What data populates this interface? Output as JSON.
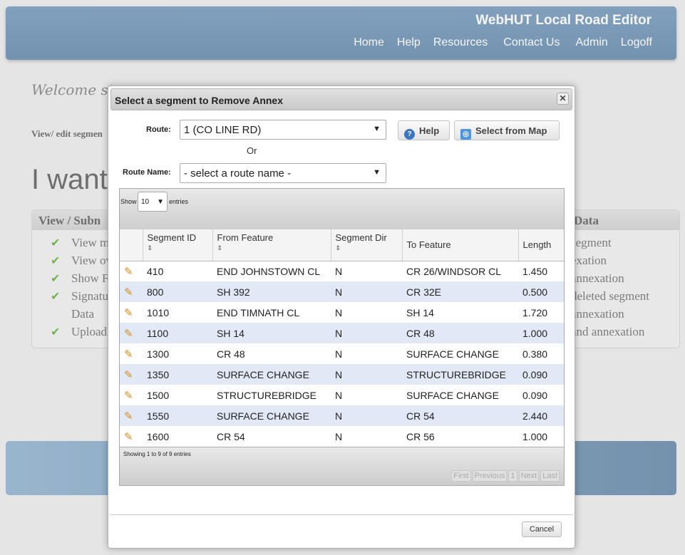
{
  "header": {
    "title": "WebHUT Local Road Editor",
    "nav": [
      "Home",
      "Help",
      "Resources",
      "Contact Us",
      "Admin",
      "Logoff"
    ]
  },
  "background": {
    "welcome": "Welcome ste",
    "view_edit": "View/ edit segmen",
    "i_want": "I want",
    "left_panel": {
      "title": "View / Subn",
      "items": [
        "View m",
        "View ov",
        "Show F",
        "Signatu",
        "Data",
        "Upload"
      ]
    },
    "right_panel": {
      "title": "Data",
      "items": [
        "segment",
        "exation",
        "annexation",
        "deleted segment",
        "annexation",
        "and annexation"
      ]
    }
  },
  "dialog": {
    "title": "Select a segment to Remove Annex",
    "close_icon": "close-icon",
    "route_label": "Route:",
    "route_value": "1 (CO LINE RD)",
    "or_text": "Or",
    "route_name_label": "Route Name:",
    "route_name_value": "- select a route name -",
    "help_button": "Help",
    "map_button": "Select from Map",
    "table": {
      "show_label": "Show",
      "page_length": "10",
      "entries_label": "entries",
      "columns": [
        "",
        "Segment ID",
        "From Feature",
        "Segment Dir",
        "To Feature",
        "Length"
      ],
      "rows": [
        [
          "410",
          "END JOHNSTOWN CL",
          "N",
          "CR 26/WINDSOR CL",
          "1.450"
        ],
        [
          "800",
          "SH 392",
          "N",
          "CR 32E",
          "0.500"
        ],
        [
          "1010",
          "END TIMNATH CL",
          "N",
          "SH 14",
          "1.720"
        ],
        [
          "1100",
          "SH 14",
          "N",
          "CR 48",
          "1.000"
        ],
        [
          "1300",
          "CR 48",
          "N",
          "SURFACE CHANGE",
          "0.380"
        ],
        [
          "1350",
          "SURFACE CHANGE",
          "N",
          "STRUCTUREBRIDGE",
          "0.090"
        ],
        [
          "1500",
          "STRUCTUREBRIDGE",
          "N",
          "SURFACE CHANGE",
          "0.090"
        ],
        [
          "1550",
          "SURFACE CHANGE",
          "N",
          "CR 54",
          "2.440"
        ],
        [
          "1600",
          "CR 54",
          "N",
          "CR 56",
          "1.000"
        ]
      ],
      "info": "Showing 1 to 9 of 9 entries",
      "pager": [
        "First",
        "Previous",
        "1",
        "Next",
        "Last"
      ]
    },
    "cancel_button": "Cancel"
  },
  "colors": {
    "header_blue": "#5f84a7",
    "row_alt": "#e2e9f6",
    "check_green": "#5aa830",
    "pencil_orange": "#d98c1a"
  }
}
